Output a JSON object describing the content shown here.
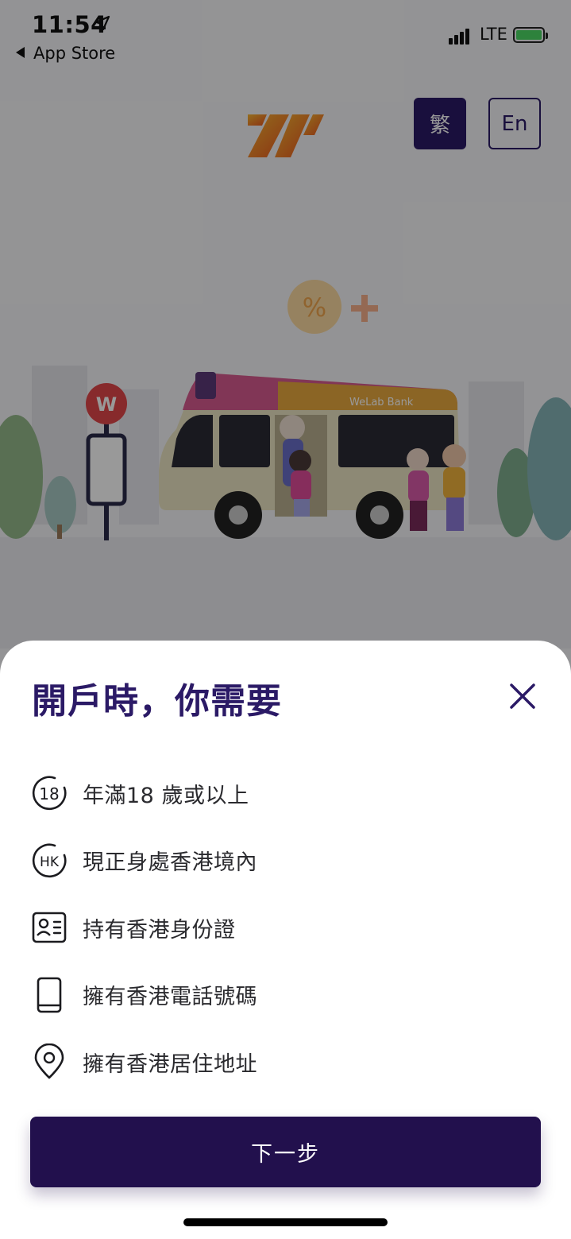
{
  "status_bar": {
    "time": "11:54",
    "back_label": "App Store",
    "network": "LTE"
  },
  "background": {
    "language_zh": "繁",
    "language_en": "En",
    "bus_brand": "WeLab Bank",
    "percent_badge": "%",
    "logo_letter": "W"
  },
  "sheet": {
    "title": "開戶時，你需要",
    "requirements": [
      {
        "icon": "age-18-icon",
        "label": "年滿18 歲或以上"
      },
      {
        "icon": "hk-location-icon",
        "label": "現正身處香港境內"
      },
      {
        "icon": "id-card-icon",
        "label": "持有香港身份證"
      },
      {
        "icon": "mobile-phone-icon",
        "label": "擁有香港電話號碼"
      },
      {
        "icon": "map-pin-icon",
        "label": "擁有香港居住地址"
      }
    ],
    "next_label": "下一步",
    "age_icon_text": "18",
    "hk_icon_text": "HK"
  },
  "colors": {
    "brand_purple": "#2b1a66",
    "button_dark": "#22104d",
    "logo_orange": "#f08a24",
    "battery_green": "#4cd964"
  }
}
